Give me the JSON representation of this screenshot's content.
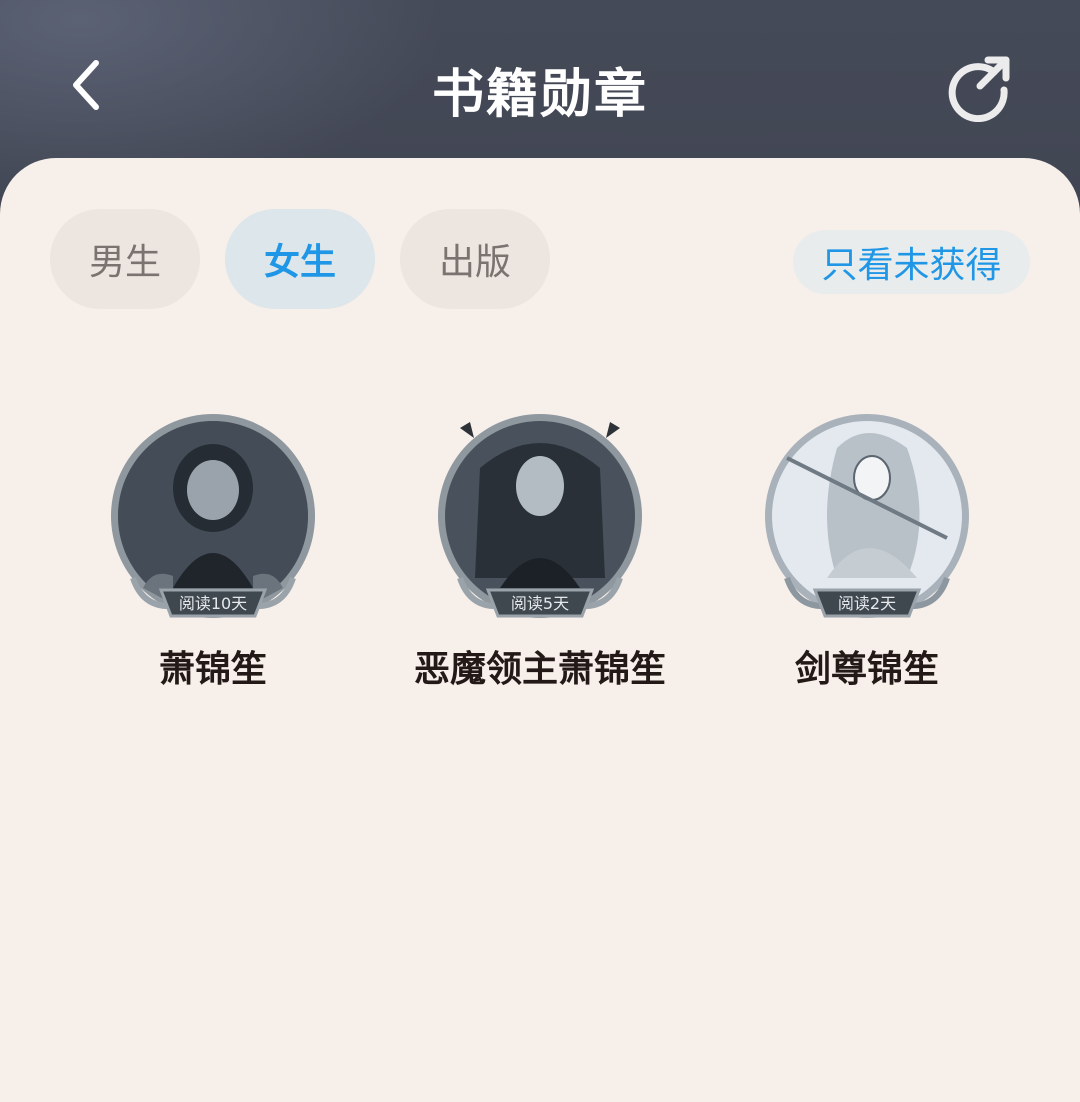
{
  "header": {
    "title": "书籍勋章",
    "back_icon": "chevron-left-icon",
    "share_icon": "share-arrow-icon"
  },
  "tabs": [
    {
      "label": "男生",
      "active": false
    },
    {
      "label": "女生",
      "active": true
    },
    {
      "label": "出版",
      "active": false
    }
  ],
  "filter_button": {
    "label": "只看未获得"
  },
  "medals": [
    {
      "name": "萧锦笙",
      "badge": "阅读10天"
    },
    {
      "name": "恶魔领主萧锦笙",
      "badge": "阅读5天"
    },
    {
      "name": "剑尊锦笙",
      "badge": "阅读2天"
    }
  ],
  "colors": {
    "accent": "#1f97e6",
    "header_bg": "#3a3d48",
    "content_bg": "#f7efea"
  }
}
